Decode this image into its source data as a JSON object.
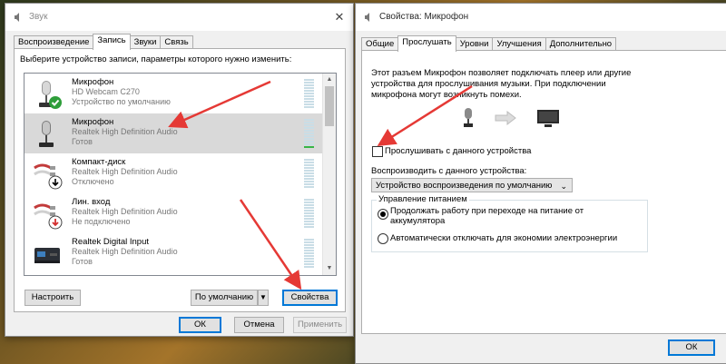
{
  "sound_window": {
    "title": "Звук",
    "tabs": [
      "Воспроизведение",
      "Запись",
      "Звуки",
      "Связь"
    ],
    "active_tab": 1,
    "instruction": "Выберите устройство записи, параметры которого нужно изменить:",
    "devices": [
      {
        "name": "Микрофон",
        "sub": "HD Webcam C270",
        "status": "Устройство по умолчанию",
        "icon": "microphone-default-icon"
      },
      {
        "name": "Микрофон",
        "sub": "Realtek High Definition Audio",
        "status": "Готов",
        "icon": "microphone-icon",
        "selected": true
      },
      {
        "name": "Компакт-диск",
        "sub": "Realtek High Definition Audio",
        "status": "Отключено",
        "icon": "cd-audio-icon"
      },
      {
        "name": "Лин. вход",
        "sub": "Realtek High Definition Audio",
        "status": "Не подключено",
        "icon": "line-in-icon"
      },
      {
        "name": "Realtek Digital Input",
        "sub": "Realtek High Definition Audio",
        "status": "Готов",
        "icon": "digital-input-icon"
      }
    ],
    "buttons": {
      "configure": "Настроить",
      "default": "По умолчанию",
      "properties": "Свойства",
      "ok": "ОК",
      "cancel": "Отмена",
      "apply": "Применить"
    }
  },
  "props_window": {
    "title": "Свойства: Микрофон",
    "tabs": [
      "Общие",
      "Прослушать",
      "Уровни",
      "Улучшения",
      "Дополнительно"
    ],
    "active_tab": 1,
    "description": [
      "Этот разъем Микрофон позволяет подключать плеер или другие",
      "устройства для прослушивания музыки. При подключении",
      "микрофона могут возникнуть помехи."
    ],
    "listen_checkbox": "Прослушивать с данного устройства",
    "playback_label": "Воспроизводить с данного устройства:",
    "playback_value": "Устройство воспроизведения по умолчанию",
    "power_group": "Управление питанием",
    "power_option1": [
      "Продолжать работу при переходе на питание от",
      "аккумулятора"
    ],
    "power_option2": "Автоматически отключать для экономии электроэнергии",
    "ok": "ОК"
  },
  "colors": {
    "accent": "#0078d7",
    "annotation_arrow": "#e53935",
    "meter_active": "#38b547"
  }
}
